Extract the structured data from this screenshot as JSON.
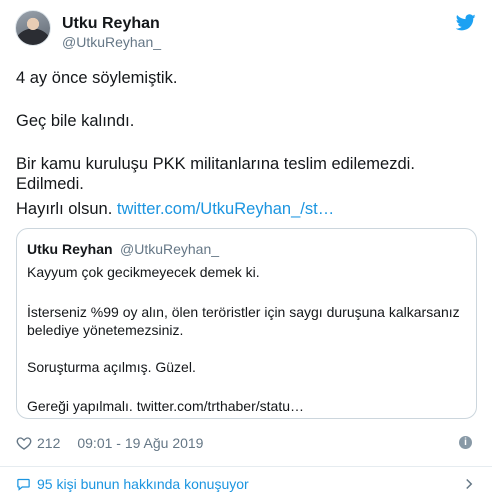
{
  "author": {
    "display_name": "Utku Reyhan",
    "handle": "@UtkuReyhan_"
  },
  "tweet": {
    "line1": "4 ay önce söylemiştik.",
    "line2": "Geç bile kalındı.",
    "line3": "Bir kamu kuruluşu PKK militanlarına teslim edilemezdi. Edilmedi.",
    "line4_text": "Hayırlı olsun. ",
    "line4_link": "twitter.com/UtkuReyhan_/st…"
  },
  "quoted_tweet": {
    "display_name": "Utku Reyhan",
    "handle": "@UtkuReyhan_",
    "line1": "Kayyum çok gecikmeyecek demek ki.",
    "line2": "İsterseniz %99 oy alın, ölen teröristler için saygı duruşuna kalkarsanız belediye yönetemezsiniz.",
    "line3": "Soruşturma açılmış. Güzel.",
    "line4": "Gereği yapılmalı. twitter.com/trthaber/statu…"
  },
  "meta": {
    "like_count": "212",
    "timestamp": "09:01 - 19 Ağu 2019"
  },
  "conversation": {
    "label": "95 kişi bunun hakkında konuşuyor"
  },
  "colors": {
    "link": "#1b95e0",
    "text": "#14171a",
    "secondary": "#657786",
    "border": "#ccd6dd",
    "twitter_blue": "#1da1f2"
  },
  "icons": {
    "brand": "twitter-bird-icon",
    "like": "heart-icon",
    "info": "info-icon",
    "conversation": "speech-bubble-icon",
    "chevron": "chevron-right-icon"
  }
}
